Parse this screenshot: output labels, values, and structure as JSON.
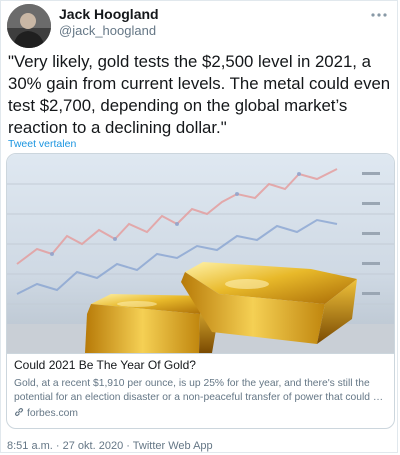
{
  "author": {
    "name": "Jack Hoogland",
    "handle": "@jack_hoogland"
  },
  "more_icon": "more-options-icon",
  "tweet": {
    "text": "\"Very likely, gold tests the $2,500 level in 2021, a 30% gain from current levels. The metal could even test $2,700, depending on the global market’s reaction to a declining dollar.\"",
    "translate_label": "Tweet vertalen"
  },
  "card": {
    "title": "Could 2021 Be The Year Of Gold?",
    "description": "Gold, at a recent $1,910 per ounce, is up 25% for the year, and there's still the potential for an election disaster or a non-peaceful transfer of power that could …",
    "domain": "forbes.com",
    "link_icon": "link-icon"
  },
  "meta": {
    "text": "8:51 a.m. · 27 okt. 2020 · Twitter Web App"
  },
  "colors": {
    "link": "#1b95e0",
    "secondary_text": "#657786",
    "border": "#ccd6dd",
    "gold": "#d4a017"
  }
}
